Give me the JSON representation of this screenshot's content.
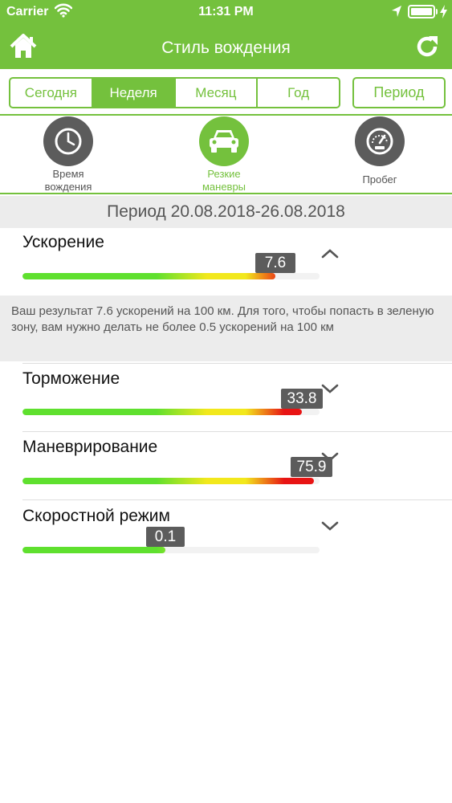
{
  "status_bar": {
    "carrier": "Carrier",
    "time": "11:31 PM",
    "icons": [
      "wifi-icon",
      "location-arrow-icon",
      "battery-icon",
      "charging-bolt-icon"
    ]
  },
  "header": {
    "title": "Стиль вождения",
    "left_icon": "home-icon",
    "right_icon": "refresh-icon"
  },
  "range_tabs": [
    {
      "label": "Сегодня",
      "selected": false
    },
    {
      "label": "Неделя",
      "selected": true
    },
    {
      "label": "Месяц",
      "selected": false
    },
    {
      "label": "Год",
      "selected": false
    }
  ],
  "period_button": "Период",
  "modes": [
    {
      "label_line1": "Время",
      "label_line2": "вождения",
      "icon": "clock-icon",
      "active": false
    },
    {
      "label_line1": "Резкие",
      "label_line2": "маневры",
      "icon": "car-icon",
      "active": true
    },
    {
      "label_line1": "Пробег",
      "label_line2": "",
      "icon": "speedometer-icon",
      "active": false
    }
  ],
  "period_text": "Период 20.08.2018-26.08.2018",
  "metrics": [
    {
      "name": "Ускорение",
      "value": "7.6",
      "level": 0.85,
      "expanded": true
    },
    {
      "name": "Торможение",
      "value": "33.8",
      "level": 0.94,
      "expanded": false
    },
    {
      "name": "Маневрирование",
      "value": "75.9",
      "level": 0.98,
      "expanded": false
    },
    {
      "name": "Скоростной режим",
      "value": "0.1",
      "level": 0.48,
      "expanded": false
    }
  ],
  "info_text": "Ваш результат 7.6 ускорений на 100 км. Для того, чтобы попасть в зеленую зону, вам нужно делать не более 0.5 ускорений на 100 км",
  "colors": {
    "accent": "#74c13d",
    "gauge_green": "#5fe02e",
    "gauge_yellow": "#f2e81c",
    "gauge_red": "#e81414",
    "tag_bg": "#5c5c5c"
  }
}
